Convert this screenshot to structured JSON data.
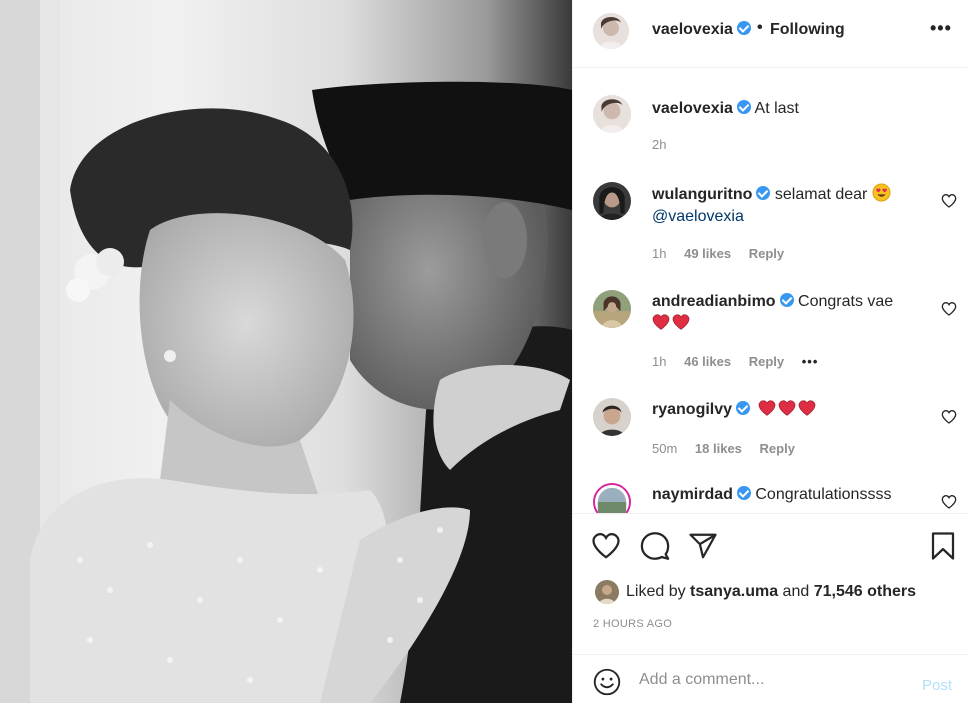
{
  "header": {
    "username": "vaelovexia",
    "separator": "•",
    "follow_status": "Following",
    "more_label": "•••"
  },
  "comments": [
    {
      "username": "vaelovexia",
      "text": "At last",
      "time": "2h",
      "likes": "",
      "reply": "",
      "is_caption": true
    },
    {
      "username": "wulanguritno",
      "text": "selamat dear",
      "mention": "@vaelovexia",
      "time": "1h",
      "likes": "49 likes",
      "reply": "Reply"
    },
    {
      "username": "andreadianbimo",
      "text": "Congrats vae",
      "time": "1h",
      "likes": "46 likes",
      "reply": "Reply",
      "more": "•••"
    },
    {
      "username": "ryanogilvy",
      "text": "",
      "time": "50m",
      "likes": "18 likes",
      "reply": "Reply"
    },
    {
      "username": "naymirdad",
      "text": "Congratulationssss"
    }
  ],
  "icons": [
    "heart-icon",
    "comment-icon",
    "share-icon",
    "bookmark-icon",
    "emoji-icon"
  ],
  "liked_by": {
    "prefix": "Liked by",
    "user": "tsanya.uma",
    "conjunction": "and",
    "others": "71,546 others"
  },
  "timestamp": "2 HOURS AGO",
  "add_comment": {
    "placeholder": "Add a comment...",
    "post_label": "Post"
  },
  "colors": {
    "verified": "#3897f0",
    "post_disabled": "#b2dffc",
    "meta_gray": "#8e8e8e",
    "heart_red": "#e0245e"
  }
}
